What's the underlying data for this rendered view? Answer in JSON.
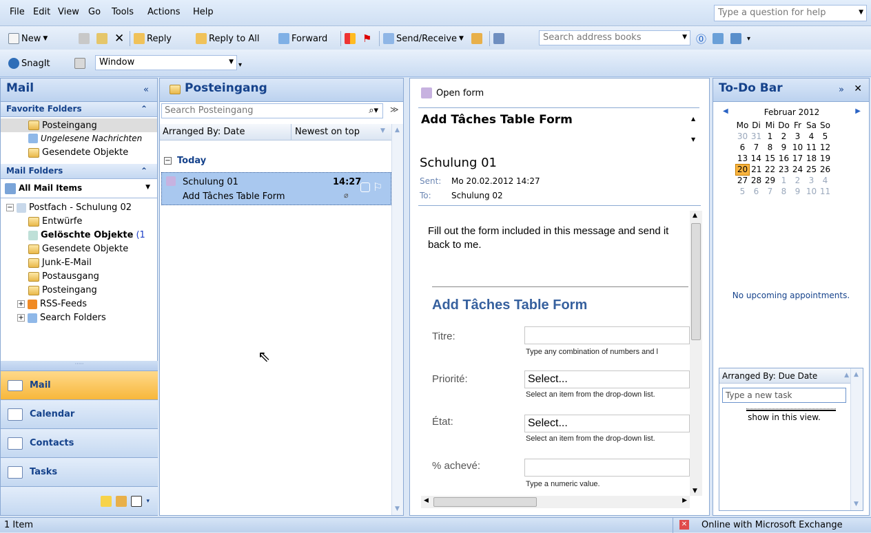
{
  "menu": [
    "File",
    "Edit",
    "View",
    "Go",
    "Tools",
    "Actions",
    "Help"
  ],
  "help_placeholder": "Type a question for help",
  "toolbar": {
    "new": "New",
    "reply": "Reply",
    "reply_all": "Reply to All",
    "forward": "Forward",
    "send_receive": "Send/Receive",
    "search_address": "Search address books"
  },
  "toolbar2": {
    "snagit": "SnagIt",
    "window": "Window"
  },
  "nav": {
    "title": "Mail",
    "favorites_label": "Favorite Folders",
    "favorites": [
      "Posteingang",
      "Ungelesene Nachrichten",
      "Gesendete Objekte"
    ],
    "mail_folders_label": "Mail Folders",
    "all_mail": "All Mail Items",
    "mailbox": "Postfach - Schulung 02",
    "folders": [
      "Entwürfe",
      "Gelöschte Objekte",
      "Gesendete Objekte",
      "Junk-E-Mail",
      "Postausgang",
      "Posteingang",
      "RSS-Feeds",
      "Search Folders"
    ],
    "deleted_count": "(1",
    "buttons": [
      "Mail",
      "Calendar",
      "Contacts",
      "Tasks"
    ]
  },
  "list": {
    "title": "Posteingang",
    "search_placeholder": "Search Posteingang",
    "arranged": "Arranged By: Date",
    "order": "Newest on top",
    "group": "Today",
    "item": {
      "from": "Schulung 01",
      "time": "14:27",
      "subject": "Add Tâches Table Form"
    }
  },
  "reading": {
    "open_form": "Open form",
    "subject": "Add Tâches Table Form",
    "from": "Schulung 01",
    "sent_label": "Sent:",
    "sent": "Mo 20.02.2012 14:27",
    "to_label": "To:",
    "to": "Schulung 02",
    "body": "Fill out the form included in this message and send it back to me.",
    "form_title": "Add Tâches Table Form",
    "f_titre": "Titre:",
    "f_titre_hint": "Type any combination of numbers and l",
    "f_prio": "Priorité:",
    "f_prio_val": "Select...",
    "f_prio_hint": "Select an item from the drop-down list.",
    "f_etat": "État:",
    "f_etat_val": "Select...",
    "f_etat_hint": "Select an item from the drop-down list.",
    "f_pct": "% achevé:",
    "f_pct_hint": "Type a numeric value."
  },
  "todo": {
    "title": "To-Do Bar",
    "month": "Februar 2012",
    "days": [
      "Mo",
      "Di",
      "Mi",
      "Do",
      "Fr",
      "Sa",
      "So"
    ],
    "weeks": [
      [
        "30",
        "31",
        "1",
        "2",
        "3",
        "4",
        "5"
      ],
      [
        "6",
        "7",
        "8",
        "9",
        "10",
        "11",
        "12"
      ],
      [
        "13",
        "14",
        "15",
        "16",
        "17",
        "18",
        "19"
      ],
      [
        "20",
        "21",
        "22",
        "23",
        "24",
        "25",
        "26"
      ],
      [
        "27",
        "28",
        "29",
        "1",
        "2",
        "3",
        "4"
      ],
      [
        "5",
        "6",
        "7",
        "8",
        "9",
        "10",
        "11"
      ]
    ],
    "today": "20",
    "no_appt": "No upcoming appointments.",
    "task_arranged": "Arranged By: Due Date",
    "new_task": "Type a new task",
    "task_note": "show in this view."
  },
  "status": {
    "items": "1 Item",
    "connection": "Online with Microsoft Exchange"
  }
}
